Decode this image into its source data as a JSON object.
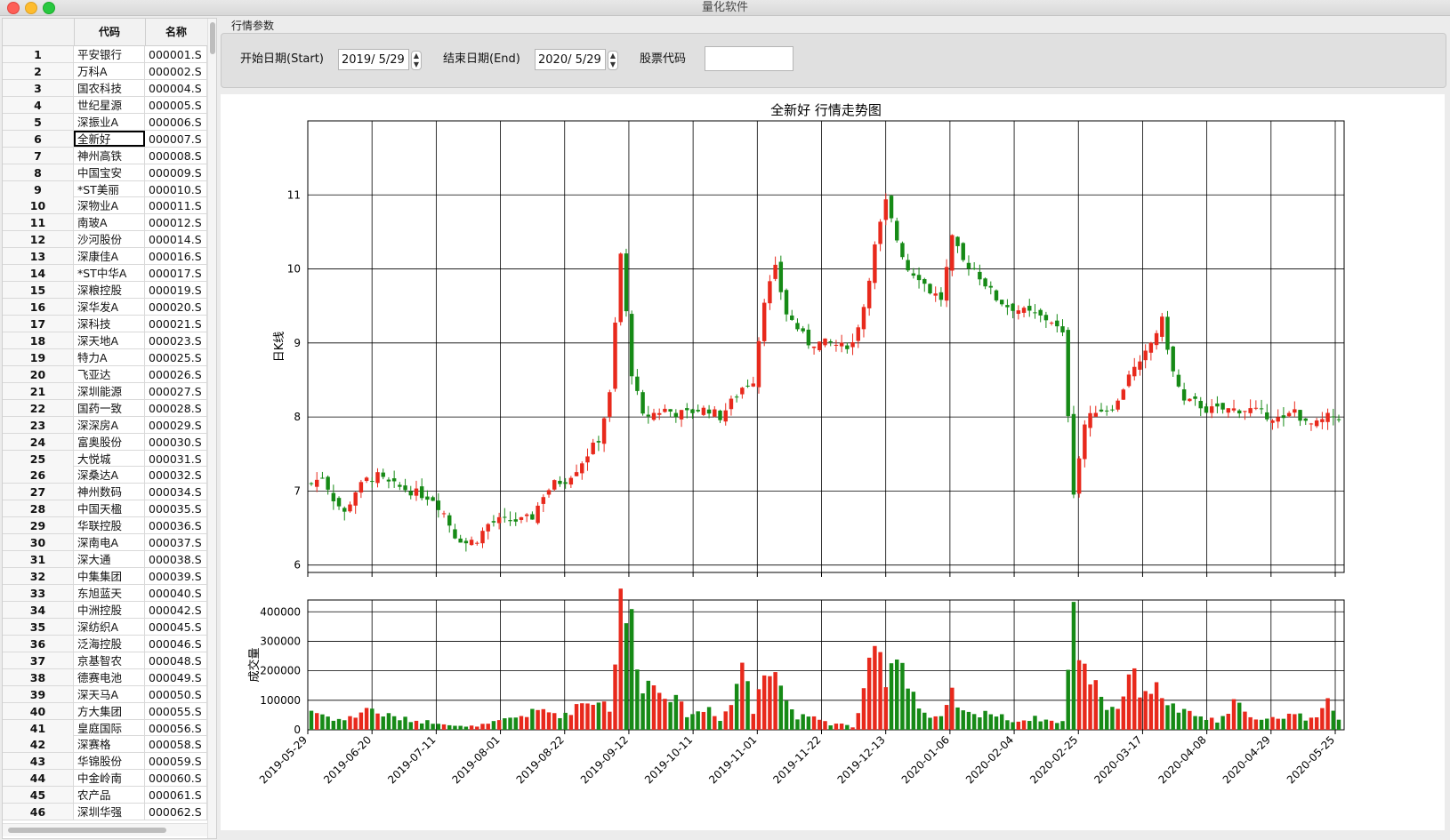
{
  "window": {
    "title": "量化软件"
  },
  "table": {
    "headers": [
      "",
      "代码",
      "名称"
    ],
    "rows": [
      [
        "1",
        "平安银行",
        "000001.S"
      ],
      [
        "2",
        "万科A",
        "000002.S"
      ],
      [
        "3",
        "国农科技",
        "000004.S"
      ],
      [
        "4",
        "世纪星源",
        "000005.S"
      ],
      [
        "5",
        "深振业A",
        "000006.S"
      ],
      [
        "6",
        "全新好",
        "000007.S"
      ],
      [
        "7",
        "神州高铁",
        "000008.S"
      ],
      [
        "8",
        "中国宝安",
        "000009.S"
      ],
      [
        "9",
        "*ST美丽",
        "000010.S"
      ],
      [
        "10",
        "深物业A",
        "000011.S"
      ],
      [
        "11",
        "南玻A",
        "000012.S"
      ],
      [
        "12",
        "沙河股份",
        "000014.S"
      ],
      [
        "13",
        "深康佳A",
        "000016.S"
      ],
      [
        "14",
        "*ST中华A",
        "000017.S"
      ],
      [
        "15",
        "深粮控股",
        "000019.S"
      ],
      [
        "16",
        "深华发A",
        "000020.S"
      ],
      [
        "17",
        "深科技",
        "000021.S"
      ],
      [
        "18",
        "深天地A",
        "000023.S"
      ],
      [
        "19",
        "特力A",
        "000025.S"
      ],
      [
        "20",
        "飞亚达",
        "000026.S"
      ],
      [
        "21",
        "深圳能源",
        "000027.S"
      ],
      [
        "22",
        "国药一致",
        "000028.S"
      ],
      [
        "23",
        "深深房A",
        "000029.S"
      ],
      [
        "24",
        "富奥股份",
        "000030.S"
      ],
      [
        "25",
        "大悦城",
        "000031.S"
      ],
      [
        "26",
        "深桑达A",
        "000032.S"
      ],
      [
        "27",
        "神州数码",
        "000034.S"
      ],
      [
        "28",
        "中国天楹",
        "000035.S"
      ],
      [
        "29",
        "华联控股",
        "000036.S"
      ],
      [
        "30",
        "深南电A",
        "000037.S"
      ],
      [
        "31",
        "深大通",
        "000038.S"
      ],
      [
        "32",
        "中集集团",
        "000039.S"
      ],
      [
        "33",
        "东旭蓝天",
        "000040.S"
      ],
      [
        "34",
        "中洲控股",
        "000042.S"
      ],
      [
        "35",
        "深纺织A",
        "000045.S"
      ],
      [
        "36",
        "泛海控股",
        "000046.S"
      ],
      [
        "37",
        "京基智农",
        "000048.S"
      ],
      [
        "38",
        "德赛电池",
        "000049.S"
      ],
      [
        "39",
        "深天马A",
        "000050.S"
      ],
      [
        "40",
        "方大集团",
        "000055.S"
      ],
      [
        "41",
        "皇庭国际",
        "000056.S"
      ],
      [
        "42",
        "深赛格",
        "000058.S"
      ],
      [
        "43",
        "华锦股份",
        "000059.S"
      ],
      [
        "44",
        "中金岭南",
        "000060.S"
      ],
      [
        "45",
        "农产品",
        "000061.S"
      ],
      [
        "46",
        "深圳华强",
        "000062.S"
      ]
    ],
    "selected_row": 6
  },
  "params": {
    "group_title": "行情参数",
    "start_label": "开始日期(Start)",
    "start_value": "2019/  5/29",
    "end_label": "结束日期(End)",
    "end_value": "2020/  5/29",
    "code_label": "股票代码",
    "code_value": ""
  },
  "chart_data": [
    {
      "type": "candlestick",
      "title": "全新好 行情走势图",
      "ylabel": "日K线",
      "xlabel": "",
      "ylim": [
        5.9,
        12.0
      ],
      "yticks": [
        6,
        7,
        8,
        9,
        10,
        11
      ],
      "grid": true,
      "up_color": "#e8291c",
      "down_color": "#168a16",
      "x_tick_labels": [
        "2019-05-29",
        "2019-06-20",
        "2019-07-11",
        "2019-08-01",
        "2019-08-22",
        "2019-09-12",
        "2019-10-11",
        "2019-11-01",
        "2019-11-22",
        "2019-12-13",
        "2020-01-06",
        "2020-02-04",
        "2020-02-25",
        "2020-03-17",
        "2020-04-08",
        "2020-04-29",
        "2020-05-25"
      ],
      "close_trend": [
        [
          0,
          7.1
        ],
        [
          2,
          7.2
        ],
        [
          4,
          6.9
        ],
        [
          6,
          6.7
        ],
        [
          8,
          7.0
        ],
        [
          10,
          7.15
        ],
        [
          12,
          7.2
        ],
        [
          14,
          7.1
        ],
        [
          16,
          7.05
        ],
        [
          18,
          7.0
        ],
        [
          20,
          6.95
        ],
        [
          22,
          6.9
        ],
        [
          24,
          6.7
        ],
        [
          26,
          6.4
        ],
        [
          28,
          6.3
        ],
        [
          30,
          6.35
        ],
        [
          32,
          6.55
        ],
        [
          34,
          6.6
        ],
        [
          36,
          6.6
        ],
        [
          38,
          6.6
        ],
        [
          40,
          6.65
        ],
        [
          42,
          6.95
        ],
        [
          44,
          7.1
        ],
        [
          46,
          7.15
        ],
        [
          48,
          7.3
        ],
        [
          50,
          7.5
        ],
        [
          52,
          7.7
        ],
        [
          54,
          8.3
        ],
        [
          56,
          10.2
        ],
        [
          58,
          8.6
        ],
        [
          60,
          8.0
        ],
        [
          62,
          8.05
        ],
        [
          64,
          8.1
        ],
        [
          66,
          8.05
        ],
        [
          68,
          8.05
        ],
        [
          70,
          8.1
        ],
        [
          72,
          8.1
        ],
        [
          74,
          8.0
        ],
        [
          76,
          8.2
        ],
        [
          78,
          8.4
        ],
        [
          80,
          8.5
        ],
        [
          82,
          9.6
        ],
        [
          84,
          10.0
        ],
        [
          86,
          9.4
        ],
        [
          88,
          9.2
        ],
        [
          90,
          9.0
        ],
        [
          92,
          9.0
        ],
        [
          94,
          9.0
        ],
        [
          96,
          8.95
        ],
        [
          98,
          9.0
        ],
        [
          100,
          9.5
        ],
        [
          102,
          10.3
        ],
        [
          104,
          10.9
        ],
        [
          106,
          10.4
        ],
        [
          108,
          10.0
        ],
        [
          110,
          9.9
        ],
        [
          112,
          9.7
        ],
        [
          114,
          9.6
        ],
        [
          116,
          10.4
        ],
        [
          118,
          10.1
        ],
        [
          120,
          10.0
        ],
        [
          122,
          9.8
        ],
        [
          124,
          9.6
        ],
        [
          126,
          9.5
        ],
        [
          128,
          9.45
        ],
        [
          130,
          9.4
        ],
        [
          132,
          9.35
        ],
        [
          134,
          9.3
        ],
        [
          136,
          9.1
        ],
        [
          138,
          7.0
        ],
        [
          140,
          7.9
        ],
        [
          142,
          8.1
        ],
        [
          144,
          8.1
        ],
        [
          146,
          8.2
        ],
        [
          148,
          8.6
        ],
        [
          150,
          8.7
        ],
        [
          152,
          9.0
        ],
        [
          154,
          9.3
        ],
        [
          156,
          8.6
        ],
        [
          158,
          8.2
        ],
        [
          160,
          8.2
        ],
        [
          162,
          8.1
        ],
        [
          164,
          8.1
        ],
        [
          166,
          8.1
        ],
        [
          168,
          8.1
        ],
        [
          170,
          8.1
        ],
        [
          172,
          8.05
        ],
        [
          174,
          8.0
        ],
        [
          176,
          7.95
        ],
        [
          178,
          8.1
        ],
        [
          180,
          7.9
        ],
        [
          182,
          7.9
        ],
        [
          184,
          8.0
        ],
        [
          186,
          8.0
        ]
      ]
    },
    {
      "type": "bar",
      "ylabel": "成交量",
      "ylim": [
        0,
        440000
      ],
      "yticks": [
        0,
        100000,
        200000,
        300000,
        400000
      ],
      "grid": true,
      "volume_trend": [
        [
          0,
          70000
        ],
        [
          4,
          40000
        ],
        [
          6,
          35000
        ],
        [
          8,
          50000
        ],
        [
          10,
          80000
        ],
        [
          12,
          60000
        ],
        [
          16,
          40000
        ],
        [
          20,
          30000
        ],
        [
          24,
          25000
        ],
        [
          26,
          15000
        ],
        [
          28,
          10000
        ],
        [
          32,
          20000
        ],
        [
          36,
          40000
        ],
        [
          40,
          60000
        ],
        [
          42,
          70000
        ],
        [
          44,
          60000
        ],
        [
          46,
          50000
        ],
        [
          48,
          90000
        ],
        [
          50,
          100000
        ],
        [
          52,
          110000
        ],
        [
          54,
          80000
        ],
        [
          56,
          430000
        ],
        [
          58,
          380000
        ],
        [
          60,
          170000
        ],
        [
          62,
          160000
        ],
        [
          64,
          150000
        ],
        [
          66,
          100000
        ],
        [
          68,
          60000
        ],
        [
          70,
          60000
        ],
        [
          72,
          80000
        ],
        [
          74,
          40000
        ],
        [
          76,
          90000
        ],
        [
          78,
          250000
        ],
        [
          80,
          60000
        ],
        [
          82,
          260000
        ],
        [
          84,
          230000
        ],
        [
          86,
          100000
        ],
        [
          88,
          50000
        ],
        [
          90,
          40000
        ],
        [
          92,
          40000
        ],
        [
          94,
          20000
        ],
        [
          96,
          20000
        ],
        [
          98,
          10000
        ],
        [
          100,
          120000
        ],
        [
          102,
          290000
        ],
        [
          104,
          200000
        ],
        [
          106,
          290000
        ],
        [
          108,
          190000
        ],
        [
          110,
          80000
        ],
        [
          112,
          40000
        ],
        [
          114,
          40000
        ],
        [
          116,
          120000
        ],
        [
          118,
          60000
        ],
        [
          120,
          50000
        ],
        [
          122,
          70000
        ],
        [
          124,
          50000
        ],
        [
          126,
          40000
        ],
        [
          128,
          30000
        ],
        [
          130,
          40000
        ],
        [
          132,
          40000
        ],
        [
          134,
          30000
        ],
        [
          136,
          30000
        ],
        [
          138,
          390000
        ],
        [
          140,
          210000
        ],
        [
          142,
          180000
        ],
        [
          144,
          80000
        ],
        [
          146,
          80000
        ],
        [
          148,
          200000
        ],
        [
          150,
          150000
        ],
        [
          152,
          150000
        ],
        [
          154,
          130000
        ],
        [
          156,
          80000
        ],
        [
          158,
          60000
        ],
        [
          160,
          50000
        ],
        [
          162,
          40000
        ],
        [
          164,
          30000
        ],
        [
          166,
          50000
        ],
        [
          168,
          130000
        ],
        [
          170,
          40000
        ],
        [
          172,
          30000
        ],
        [
          174,
          40000
        ],
        [
          176,
          50000
        ],
        [
          178,
          60000
        ],
        [
          180,
          40000
        ],
        [
          182,
          60000
        ],
        [
          184,
          90000
        ],
        [
          186,
          30000
        ]
      ]
    }
  ]
}
